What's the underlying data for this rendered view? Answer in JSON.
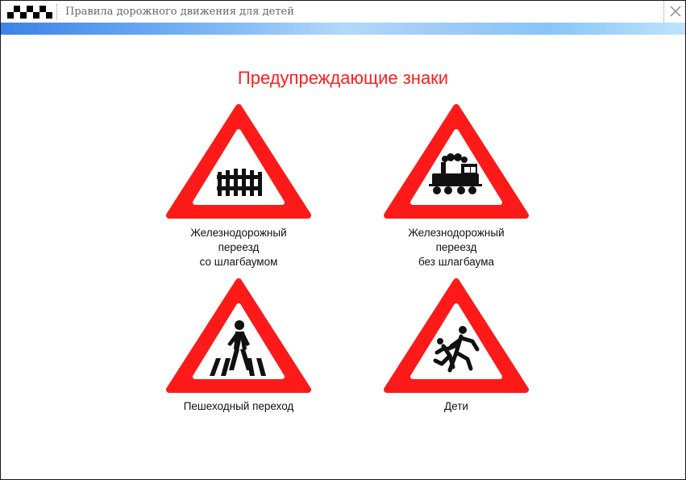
{
  "window": {
    "title": "Правила дорожного движения для детей"
  },
  "page": {
    "heading": "Предупреждающие знаки"
  },
  "signs": [
    {
      "icon": "railway-crossing-barrier-icon",
      "lines": [
        "Железнодорожный",
        "переезд",
        "со шлагбаумом"
      ]
    },
    {
      "icon": "railway-crossing-no-barrier-icon",
      "lines": [
        "Железнодорожный",
        "переезд",
        "без шлагбаума"
      ]
    },
    {
      "icon": "pedestrian-crossing-icon",
      "lines": [
        "Пешеходный переход"
      ]
    },
    {
      "icon": "children-icon",
      "lines": [
        "Дети"
      ]
    }
  ],
  "colors": {
    "sign_red": "#ff1a1a",
    "heading_red": "#ff2020",
    "accent_blue": "#3d82e6"
  }
}
